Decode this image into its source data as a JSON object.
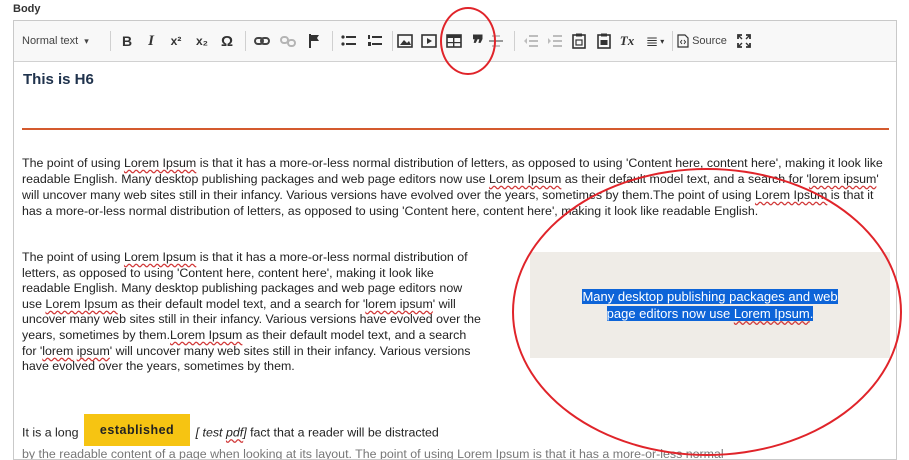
{
  "field": {
    "label": "Body"
  },
  "toolbar": {
    "format_label": "Normal text",
    "format_caret": "▾",
    "bold": "B",
    "italic": "I",
    "superscript": "x²",
    "subscript": "x₂",
    "special_char": "Ω",
    "link": "⛓",
    "flag": "⚑",
    "quote": "❞",
    "remove_format": "Tx",
    "styles_label": "≣",
    "source_label": "Source"
  },
  "content": {
    "heading": "This is H6",
    "paragraph1": {
      "parts": [
        "The point of using ",
        "Lorem Ipsum",
        " is that it has a more-or-less normal distribution of letters, as opposed to using 'Content here, content here', making it look like readable English. Many desktop publishing packages and web page editors now use ",
        "Lorem Ipsum",
        " as their default model text, and a search for '",
        "lorem ipsum",
        "' will uncover many web sites still in their infancy. Various versions have evolved over the years, sometimes by them.The point of using ",
        "Lorem Ipsum",
        " is that it has a more-or-less normal distribution of letters, as opposed to using 'Content here, content here', making it look like readable English."
      ]
    },
    "paragraph2": {
      "parts": [
        "The point of using ",
        "Lorem Ipsum",
        " is that it has a more-or-less normal distribution of letters, as opposed to using 'Content here, content here', making it look like readable English. Many desktop publishing packages and web page editors now use ",
        "Lorem Ipsum",
        " as their default model text, and a search for '",
        "lorem ipsum",
        "' will uncover many web sites still in their infancy. Various versions have evolved over the years, sometimes by them.",
        "Lorem Ipsum",
        " as their default model text, and a search for '",
        "lorem",
        " ",
        "ipsum",
        "' will uncover many web sites still in their infancy. Various versions have evolved over the years, sometimes by them."
      ]
    },
    "callout": {
      "line1": "Many desktop publishing packages and web",
      "line2_pre": "page editors now use  ",
      "line2_sq": "Lorem Ipsum",
      "line2_post": "."
    },
    "paragraph3": {
      "before": "It is a long ",
      "badge": "established",
      "emph_pre": " [ test ",
      "emph_sq": "pdf",
      "emph_post": "]",
      "after": " fact that a reader will be distracted"
    },
    "paragraph4": "by the readable content of a page when looking at its layout. The point of using Lorem Ipsum is that it has a more-or-less normal"
  },
  "colors": {
    "annotation": "#e0242a",
    "selection": "#0d64d8",
    "badge": "#f6c412",
    "rule": "#d45a2e"
  }
}
